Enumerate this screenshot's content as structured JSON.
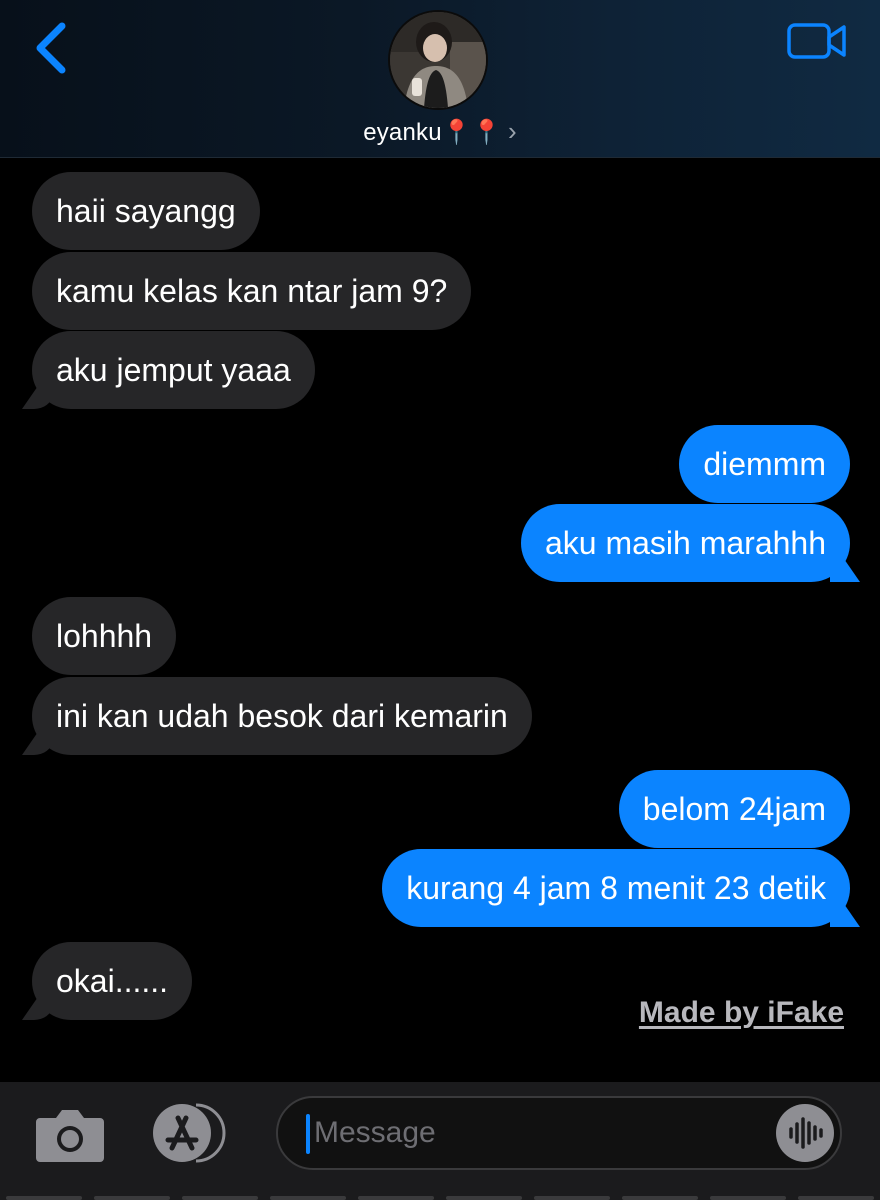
{
  "header": {
    "contact_name": "eyanku📍📍",
    "contact_chevron": "›",
    "back_icon": "chevron-left-icon",
    "video_icon": "video-camera-icon",
    "accent_color": "#0b84ff"
  },
  "messages": [
    {
      "sender": "contact",
      "text": "haii sayangg"
    },
    {
      "sender": "contact",
      "text": "kamu kelas kan ntar jam 9?"
    },
    {
      "sender": "contact",
      "text": "aku jemput yaaa"
    },
    {
      "sender": "me",
      "text": "diemmm"
    },
    {
      "sender": "me",
      "text": "aku masih marahhh"
    },
    {
      "sender": "contact",
      "text": "lohhhh"
    },
    {
      "sender": "contact",
      "text": "ini kan udah besok dari kemarin"
    },
    {
      "sender": "me",
      "text": "belom 24jam"
    },
    {
      "sender": "me",
      "text": "kurang 4 jam 8 menit 23 detik"
    },
    {
      "sender": "contact",
      "text": "okai......"
    }
  ],
  "watermark": "Made by iFake",
  "composer": {
    "placeholder": "Message",
    "camera_icon": "camera-icon",
    "appstore_icon": "app-store-icon",
    "audio_icon": "audio-waveform-icon"
  }
}
